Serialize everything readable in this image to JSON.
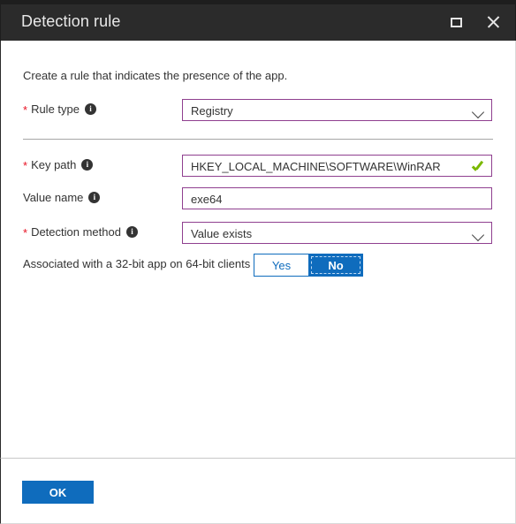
{
  "window": {
    "title": "Detection rule",
    "maximize_icon": "maximize-icon",
    "close_icon": "close-icon"
  },
  "form": {
    "intro": "Create a rule that indicates the presence of the app.",
    "info_glyph": "i",
    "required_marker": "*",
    "fields": [
      {
        "label": "Rule type",
        "required": true,
        "type": "select",
        "value": "Registry",
        "has_info": true
      },
      {
        "label": "Key path",
        "required": true,
        "type": "text",
        "value": "HKEY_LOCAL_MACHINE\\SOFTWARE\\WinRAR",
        "has_info": true,
        "validated": true
      },
      {
        "label": "Value name",
        "required": false,
        "type": "text",
        "value": "exe64",
        "has_info": true
      },
      {
        "label": "Detection method",
        "required": true,
        "type": "select",
        "value": "Value exists",
        "has_info": true
      }
    ],
    "toggle": {
      "label": "Associated with a 32-bit app on 64-bit clients",
      "has_info": true,
      "options": [
        "Yes",
        "No"
      ],
      "selected": "No"
    }
  },
  "footer": {
    "ok_label": "OK"
  },
  "colors": {
    "titlebar_bg": "#2b2b2b",
    "accent_blue": "#0f6cbd",
    "field_border_purple": "#8f3f8f",
    "required_red": "#e81123",
    "valid_green": "#7ab800"
  }
}
